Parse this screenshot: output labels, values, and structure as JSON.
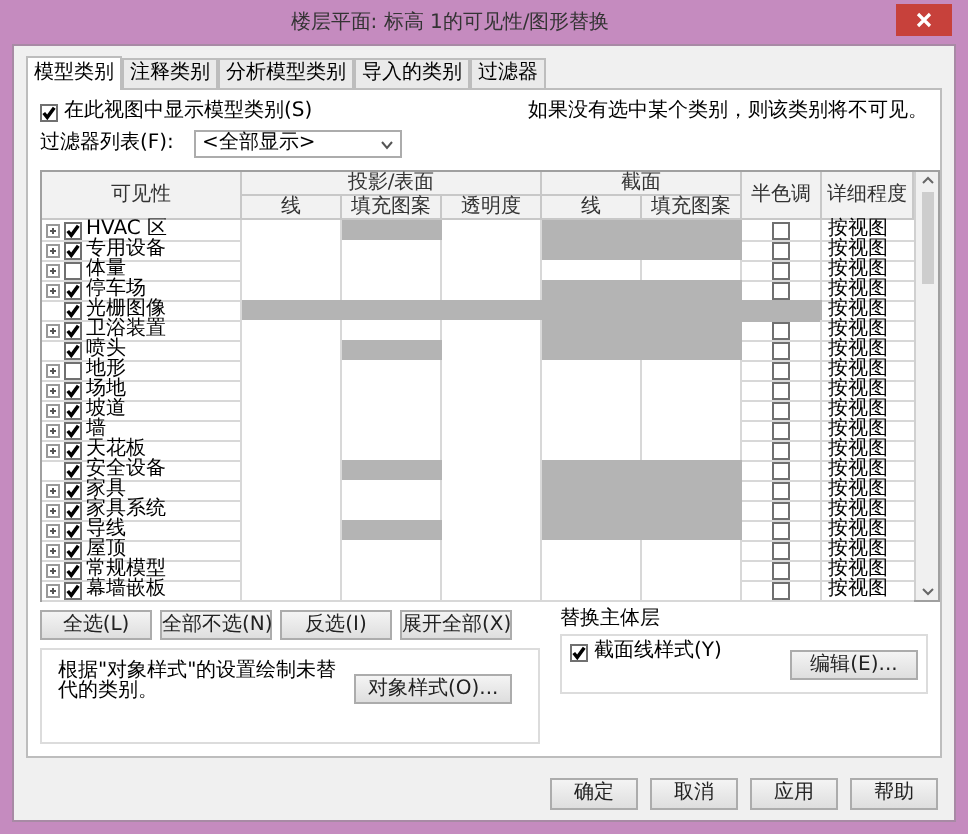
{
  "window": {
    "title": "楼层平面: 标高 1的可见性/图形替换"
  },
  "tabs": [
    {
      "label": "模型类别",
      "selected": true
    },
    {
      "label": "注释类别",
      "selected": false
    },
    {
      "label": "分析模型类别",
      "selected": false
    },
    {
      "label": "导入的类别",
      "selected": false
    },
    {
      "label": "过滤器",
      "selected": false
    }
  ],
  "show_categories": {
    "label": "在此视图中显示模型类别(S)",
    "checked": true
  },
  "hint": "如果没有选中某个类别，则该类别将不可见。",
  "filter": {
    "label": "过滤器列表(F):",
    "value": "<全部显示>"
  },
  "table": {
    "columns": {
      "visibility": "可见性",
      "projection": "投影/表面",
      "projection_sub": [
        "线",
        "填充图案",
        "透明度"
      ],
      "cut": "截面",
      "cut_sub": [
        "线",
        "填充图案"
      ],
      "halftone": "半色调",
      "detail": "详细程度"
    },
    "rows": [
      {
        "name": "HVAC 区",
        "expandable": true,
        "visible": true,
        "cells": [
          {
            "disabled": false
          },
          {
            "disabled": true
          },
          {
            "disabled": false
          },
          {
            "disabled": true
          },
          {
            "disabled": true
          }
        ],
        "halftone": {
          "disabled": false,
          "checked": false
        },
        "detail": "按视图"
      },
      {
        "name": "专用设备",
        "expandable": true,
        "visible": true,
        "cells": [
          {
            "disabled": false
          },
          {
            "disabled": false
          },
          {
            "disabled": false
          },
          {
            "disabled": true
          },
          {
            "disabled": true
          }
        ],
        "halftone": {
          "disabled": false,
          "checked": false
        },
        "detail": "按视图"
      },
      {
        "name": "体量",
        "expandable": true,
        "visible": false,
        "cells": [
          {
            "disabled": false
          },
          {
            "disabled": false
          },
          {
            "disabled": false
          },
          {
            "disabled": false
          },
          {
            "disabled": false
          }
        ],
        "halftone": {
          "disabled": false,
          "checked": false
        },
        "detail": "按视图"
      },
      {
        "name": "停车场",
        "expandable": true,
        "visible": true,
        "cells": [
          {
            "disabled": false
          },
          {
            "disabled": false
          },
          {
            "disabled": false
          },
          {
            "disabled": true
          },
          {
            "disabled": true
          }
        ],
        "halftone": {
          "disabled": false,
          "checked": false
        },
        "detail": "按视图"
      },
      {
        "name": "光栅图像",
        "expandable": false,
        "visible": true,
        "cells": [
          {
            "disabled": true
          },
          {
            "disabled": true
          },
          {
            "disabled": true
          },
          {
            "disabled": true
          },
          {
            "disabled": true
          }
        ],
        "halftone": {
          "disabled": true
        },
        "detail": "按视图"
      },
      {
        "name": "卫浴装置",
        "expandable": true,
        "visible": true,
        "cells": [
          {
            "disabled": false
          },
          {
            "disabled": false
          },
          {
            "disabled": false
          },
          {
            "disabled": true
          },
          {
            "disabled": true
          }
        ],
        "halftone": {
          "disabled": false,
          "checked": false
        },
        "detail": "按视图"
      },
      {
        "name": "喷头",
        "expandable": false,
        "visible": true,
        "cells": [
          {
            "disabled": false
          },
          {
            "disabled": true
          },
          {
            "disabled": false
          },
          {
            "disabled": true
          },
          {
            "disabled": true
          }
        ],
        "halftone": {
          "disabled": false,
          "checked": false
        },
        "detail": "按视图"
      },
      {
        "name": "地形",
        "expandable": true,
        "visible": false,
        "cells": [
          {
            "disabled": false
          },
          {
            "disabled": false
          },
          {
            "disabled": false
          },
          {
            "disabled": false
          },
          {
            "disabled": false
          }
        ],
        "halftone": {
          "disabled": false,
          "checked": false
        },
        "detail": "按视图"
      },
      {
        "name": "场地",
        "expandable": true,
        "visible": true,
        "cells": [
          {
            "disabled": false
          },
          {
            "disabled": false
          },
          {
            "disabled": false
          },
          {
            "disabled": false
          },
          {
            "disabled": false
          }
        ],
        "halftone": {
          "disabled": false,
          "checked": false
        },
        "detail": "按视图"
      },
      {
        "name": "坡道",
        "expandable": true,
        "visible": true,
        "cells": [
          {
            "disabled": false
          },
          {
            "disabled": false
          },
          {
            "disabled": false
          },
          {
            "disabled": false
          },
          {
            "disabled": false
          }
        ],
        "halftone": {
          "disabled": false,
          "checked": false
        },
        "detail": "按视图"
      },
      {
        "name": "墙",
        "expandable": true,
        "visible": true,
        "cells": [
          {
            "disabled": false
          },
          {
            "disabled": false
          },
          {
            "disabled": false
          },
          {
            "disabled": false
          },
          {
            "disabled": false
          }
        ],
        "halftone": {
          "disabled": false,
          "checked": false
        },
        "detail": "按视图"
      },
      {
        "name": "天花板",
        "expandable": true,
        "visible": true,
        "cells": [
          {
            "disabled": false
          },
          {
            "disabled": false
          },
          {
            "disabled": false
          },
          {
            "disabled": false
          },
          {
            "disabled": false
          }
        ],
        "halftone": {
          "disabled": false,
          "checked": false
        },
        "detail": "按视图"
      },
      {
        "name": "安全设备",
        "expandable": false,
        "visible": true,
        "cells": [
          {
            "disabled": false
          },
          {
            "disabled": true
          },
          {
            "disabled": false
          },
          {
            "disabled": true
          },
          {
            "disabled": true
          }
        ],
        "halftone": {
          "disabled": false,
          "checked": false
        },
        "detail": "按视图"
      },
      {
        "name": "家具",
        "expandable": true,
        "visible": true,
        "cells": [
          {
            "disabled": false
          },
          {
            "disabled": false
          },
          {
            "disabled": false
          },
          {
            "disabled": true
          },
          {
            "disabled": true
          }
        ],
        "halftone": {
          "disabled": false,
          "checked": false
        },
        "detail": "按视图"
      },
      {
        "name": "家具系统",
        "expandable": true,
        "visible": true,
        "cells": [
          {
            "disabled": false
          },
          {
            "disabled": false
          },
          {
            "disabled": false
          },
          {
            "disabled": true
          },
          {
            "disabled": true
          }
        ],
        "halftone": {
          "disabled": false,
          "checked": false
        },
        "detail": "按视图"
      },
      {
        "name": "导线",
        "expandable": true,
        "visible": true,
        "cells": [
          {
            "disabled": false
          },
          {
            "disabled": true
          },
          {
            "disabled": false
          },
          {
            "disabled": true
          },
          {
            "disabled": true
          }
        ],
        "halftone": {
          "disabled": false,
          "checked": false
        },
        "detail": "按视图"
      },
      {
        "name": "屋顶",
        "expandable": true,
        "visible": true,
        "cells": [
          {
            "disabled": false
          },
          {
            "disabled": false
          },
          {
            "disabled": false
          },
          {
            "disabled": false
          },
          {
            "disabled": false
          }
        ],
        "halftone": {
          "disabled": false,
          "checked": false
        },
        "detail": "按视图"
      },
      {
        "name": "常规模型",
        "expandable": true,
        "visible": true,
        "cells": [
          {
            "disabled": false
          },
          {
            "disabled": false
          },
          {
            "disabled": false
          },
          {
            "disabled": false
          },
          {
            "disabled": false
          }
        ],
        "halftone": {
          "disabled": false,
          "checked": false
        },
        "detail": "按视图"
      },
      {
        "name": "幕墙嵌板",
        "expandable": true,
        "visible": true,
        "cells": [
          {
            "disabled": false
          },
          {
            "disabled": false
          },
          {
            "disabled": false
          },
          {
            "disabled": false
          },
          {
            "disabled": false
          }
        ],
        "halftone": {
          "disabled": false,
          "checked": false
        },
        "detail": "按视图"
      }
    ]
  },
  "table_buttons": [
    "全选(L)",
    "全部不选(N)",
    "反选(I)",
    "展开全部(X)"
  ],
  "object_styles": {
    "text": "根据\"对象样式\"的设置绘制未替代的类别。",
    "button": "对象样式(O)..."
  },
  "host_layers": {
    "title": "替换主体层",
    "checkbox": {
      "label": "截面线样式(Y)",
      "checked": true
    },
    "button": "编辑(E)..."
  },
  "footer_buttons": [
    "确定",
    "取消",
    "应用",
    "帮助"
  ]
}
